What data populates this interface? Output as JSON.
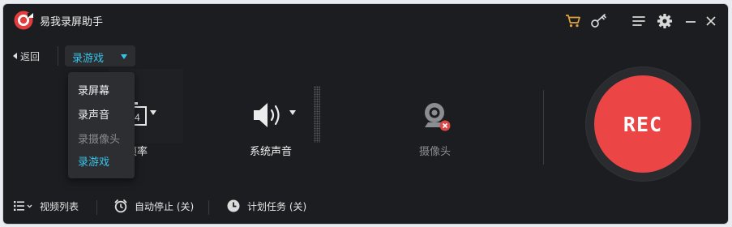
{
  "app": {
    "title": "易我录屏助手",
    "colors": {
      "accent": "#38c4ea",
      "record": "#ec4545",
      "background": "#1c1d20"
    }
  },
  "titlebar": {
    "icons": [
      "cart-icon",
      "key-icon",
      "menu-icon",
      "settings-icon",
      "minimize-icon",
      "close-icon"
    ]
  },
  "mode_bar": {
    "back_label": "返回",
    "selected_mode": "录游戏"
  },
  "mode_dropdown": {
    "options": [
      {
        "label": "录屏幕",
        "state": "normal"
      },
      {
        "label": "录声音",
        "state": "normal"
      },
      {
        "label": "录摄像头",
        "state": "disabled"
      },
      {
        "label": "录游戏",
        "state": "selected"
      }
    ]
  },
  "controls": {
    "fps": {
      "icon": "fps-icon",
      "value_glyph": "4",
      "label": "帧率"
    },
    "system_sound": {
      "icon": "speaker-icon",
      "label": "系统声音"
    },
    "camera": {
      "icon": "webcam-icon",
      "label": "摄像头",
      "enabled": false
    }
  },
  "rec_button": {
    "label": "REC"
  },
  "bottom_bar": {
    "video_list": "视频列表",
    "auto_stop": "自动停止 (关)",
    "schedule": "计划任务 (关)"
  }
}
